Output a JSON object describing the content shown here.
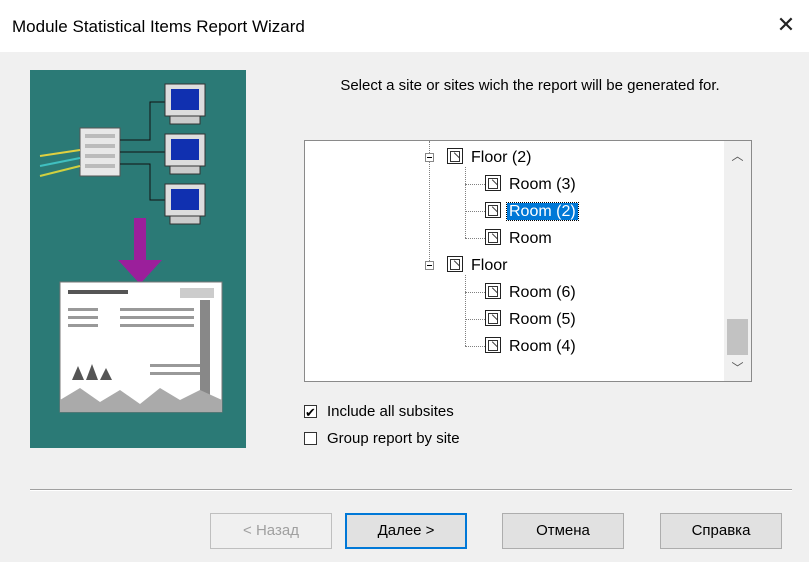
{
  "window": {
    "title": "Module Statistical Items Report Wizard",
    "close_icon": "close-icon"
  },
  "instruction": "Select a site or sites wich the report will be generated for.",
  "tree": {
    "nodes": [
      {
        "label": "Floor (2)",
        "type": "floor",
        "expanded": true,
        "selected": false
      },
      {
        "label": "Room (3)",
        "type": "room",
        "selected": false
      },
      {
        "label": "Room (2)",
        "type": "room",
        "selected": true
      },
      {
        "label": "Room",
        "type": "room",
        "selected": false
      },
      {
        "label": "Floor",
        "type": "floor",
        "expanded": true,
        "selected": false
      },
      {
        "label": "Room (6)",
        "type": "room",
        "selected": false
      },
      {
        "label": "Room (5)",
        "type": "room",
        "selected": false
      },
      {
        "label": "Room (4)",
        "type": "room",
        "selected": false
      }
    ],
    "selection_color": "#0078d7"
  },
  "options": {
    "include_subsites": {
      "label": "Include all subsites",
      "checked": true
    },
    "group_by_site": {
      "label": "Group report by site",
      "checked": false
    }
  },
  "buttons": {
    "back": "< Назад",
    "next": "Далее >",
    "cancel": "Отмена",
    "help": "Справка"
  },
  "illustration": {
    "background": "#2b7a76",
    "arrow_color": "#9b1f9b"
  }
}
